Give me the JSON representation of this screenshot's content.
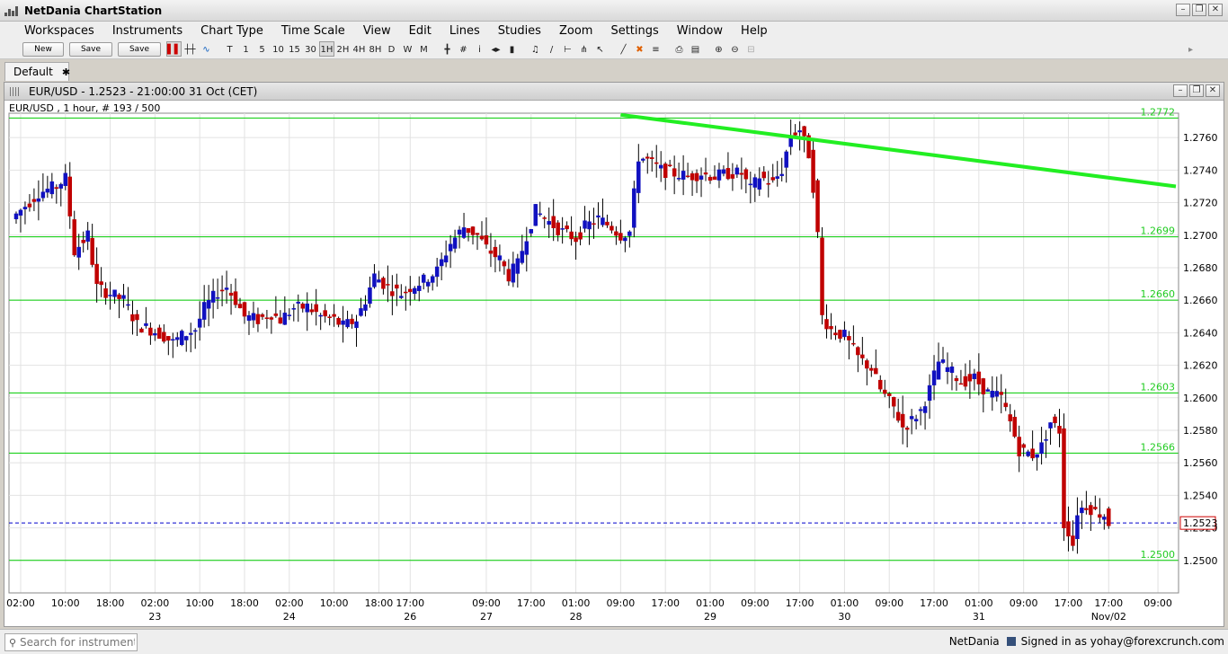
{
  "window": {
    "title": "NetDania ChartStation"
  },
  "menu": [
    "Workspaces",
    "Instruments",
    "Chart Type",
    "Time Scale",
    "View",
    "Edit",
    "Lines",
    "Studies",
    "Zoom",
    "Settings",
    "Window",
    "Help"
  ],
  "toolbar": {
    "new_label": "New",
    "save_label": "Save",
    "saveas_label": "Save as..",
    "chart_type_icons": [
      "candlestick-icon",
      "ohlc-bars-icon",
      "line-chart-icon"
    ],
    "interval_buttons": [
      "T",
      "1",
      "5",
      "10",
      "15",
      "30",
      "1H",
      "2H",
      "4H",
      "8H",
      "D",
      "W",
      "M"
    ],
    "selected_interval": "1H"
  },
  "tabs": [
    {
      "label": "Default"
    }
  ],
  "chart": {
    "title": "EUR/USD - 1.2523 - 21:00:00  31 Oct (CET)",
    "info": "EUR/USD , 1 hour, # 193 / 500"
  },
  "status": {
    "search_placeholder": "Search for instrument",
    "brand": "NetDania",
    "signed_in": "Signed in as yohay@forexcrunch.com"
  },
  "chart_data": {
    "type": "candlestick",
    "instrument": "EUR/USD",
    "interval": "1 hour",
    "last_price": 1.2523,
    "ylim": [
      1.248,
      1.2775
    ],
    "yticks": [
      1.25,
      1.252,
      1.254,
      1.256,
      1.258,
      1.26,
      1.262,
      1.264,
      1.266,
      1.268,
      1.27,
      1.272,
      1.274,
      1.276
    ],
    "ytick_labels": [
      "1.2500",
      "1.2520",
      "1.2540",
      "1.2560",
      "1.2580",
      "1.2600",
      "1.2620",
      "1.2640",
      "1.2660",
      "1.2680",
      "1.2700",
      "1.2720",
      "1.2740",
      "1.2760"
    ],
    "x_ticks": [
      {
        "i": 2,
        "time": "02:00",
        "date": ""
      },
      {
        "i": 12,
        "time": "10:00",
        "date": ""
      },
      {
        "i": 22,
        "time": "18:00",
        "date": ""
      },
      {
        "i": 32,
        "time": "02:00",
        "date": "23"
      },
      {
        "i": 42,
        "time": "10:00",
        "date": ""
      },
      {
        "i": 52,
        "time": "18:00",
        "date": ""
      },
      {
        "i": 62,
        "time": "02:00",
        "date": "24"
      },
      {
        "i": 72,
        "time": "10:00",
        "date": ""
      },
      {
        "i": 82,
        "time": "18:00",
        "date": ""
      },
      {
        "i": 89,
        "time": "17:00",
        "date": "26"
      },
      {
        "i": 106,
        "time": "09:00",
        "date": "27"
      },
      {
        "i": 116,
        "time": "17:00",
        "date": ""
      },
      {
        "i": 126,
        "time": "01:00",
        "date": "28"
      },
      {
        "i": 136,
        "time": "09:00",
        "date": ""
      },
      {
        "i": 146,
        "time": "17:00",
        "date": ""
      },
      {
        "i": 156,
        "time": "01:00",
        "date": "29"
      },
      {
        "i": 166,
        "time": "09:00",
        "date": ""
      },
      {
        "i": 176,
        "time": "17:00",
        "date": ""
      },
      {
        "i": 186,
        "time": "01:00",
        "date": "30"
      },
      {
        "i": 196,
        "time": "09:00",
        "date": ""
      },
      {
        "i": 206,
        "time": "17:00",
        "date": ""
      },
      {
        "i": 216,
        "time": "01:00",
        "date": "31"
      },
      {
        "i": 226,
        "time": "09:00",
        "date": ""
      },
      {
        "i": 236,
        "time": "17:00",
        "date": ""
      },
      {
        "i": 245,
        "time": "17:00",
        "date": "Nov/02"
      },
      {
        "i": 256,
        "time": "09:00",
        "date": ""
      }
    ],
    "horizontal_lines": [
      {
        "value": 1.2772,
        "label": "1.2772",
        "color": "#00cc00"
      },
      {
        "value": 1.2699,
        "label": "1.2699",
        "color": "#00cc00"
      },
      {
        "value": 1.266,
        "label": "1.2660",
        "color": "#00cc00"
      },
      {
        "value": 1.2603,
        "label": "1.2603",
        "color": "#00cc00"
      },
      {
        "value": 1.2566,
        "label": "1.2566",
        "color": "#00cc00"
      },
      {
        "value": 1.25,
        "label": "1.2500",
        "color": "#00cc00"
      }
    ],
    "trendline": {
      "start": {
        "i": 136,
        "value": 1.2774
      },
      "end": {
        "i": 260,
        "value": 1.273
      },
      "color": "#22ee22"
    },
    "last_price_line": {
      "value": 1.2523,
      "label": "1.2523",
      "color": "#0000cc"
    },
    "up_color": "#1010c0",
    "down_color": "#c00000",
    "ohlc_keypoints": [
      [
        0,
        1.271
      ],
      [
        3,
        1.2718
      ],
      [
        6,
        1.2726
      ],
      [
        10,
        1.273
      ],
      [
        12,
        1.2735
      ],
      [
        14,
        1.269
      ],
      [
        17,
        1.27
      ],
      [
        19,
        1.2668
      ],
      [
        22,
        1.2664
      ],
      [
        25,
        1.266
      ],
      [
        28,
        1.2645
      ],
      [
        31,
        1.2642
      ],
      [
        34,
        1.2638
      ],
      [
        36,
        1.2634
      ],
      [
        38,
        1.2638
      ],
      [
        41,
        1.2642
      ],
      [
        43,
        1.2655
      ],
      [
        46,
        1.2665
      ],
      [
        48,
        1.2668
      ],
      [
        50,
        1.266
      ],
      [
        52,
        1.265
      ],
      [
        55,
        1.2648
      ],
      [
        58,
        1.2652
      ],
      [
        60,
        1.2648
      ],
      [
        63,
        1.2655
      ],
      [
        66,
        1.2656
      ],
      [
        69,
        1.265
      ],
      [
        72,
        1.2648
      ],
      [
        74,
        1.2644
      ],
      [
        77,
        1.2648
      ],
      [
        79,
        1.266
      ],
      [
        81,
        1.2675
      ],
      [
        84,
        1.2668
      ],
      [
        87,
        1.2664
      ],
      [
        89,
        1.2668
      ],
      [
        92,
        1.2672
      ],
      [
        95,
        1.2678
      ],
      [
        98,
        1.2695
      ],
      [
        101,
        1.2705
      ],
      [
        104,
        1.27
      ],
      [
        106,
        1.2692
      ],
      [
        109,
        1.2685
      ],
      [
        111,
        1.2675
      ],
      [
        113,
        1.2682
      ],
      [
        115,
        1.27
      ],
      [
        117,
        1.2715
      ],
      [
        120,
        1.2708
      ],
      [
        123,
        1.2702
      ],
      [
        126,
        1.2698
      ],
      [
        128,
        1.2705
      ],
      [
        131,
        1.271
      ],
      [
        134,
        1.2705
      ],
      [
        136,
        1.27
      ],
      [
        138,
        1.2702
      ],
      [
        140,
        1.2748
      ],
      [
        142,
        1.2746
      ],
      [
        145,
        1.274
      ],
      [
        148,
        1.2738
      ],
      [
        151,
        1.2736
      ],
      [
        154,
        1.2738
      ],
      [
        157,
        1.2736
      ],
      [
        160,
        1.2738
      ],
      [
        163,
        1.2738
      ],
      [
        165,
        1.2728
      ],
      [
        167,
        1.2736
      ],
      [
        170,
        1.2732
      ],
      [
        172,
        1.274
      ],
      [
        174,
        1.2762
      ],
      [
        176,
        1.2765
      ],
      [
        178,
        1.275
      ],
      [
        179,
        1.273
      ],
      [
        180,
        1.27
      ],
      [
        181,
        1.265
      ],
      [
        183,
        1.2642
      ],
      [
        186,
        1.2638
      ],
      [
        189,
        1.2625
      ],
      [
        192,
        1.2618
      ],
      [
        194,
        1.2605
      ],
      [
        197,
        1.2594
      ],
      [
        199,
        1.2582
      ],
      [
        201,
        1.2586
      ],
      [
        203,
        1.2592
      ],
      [
        205,
        1.2605
      ],
      [
        207,
        1.2622
      ],
      [
        209,
        1.2618
      ],
      [
        212,
        1.261
      ],
      [
        215,
        1.2612
      ],
      [
        218,
        1.2603
      ],
      [
        221,
        1.26
      ],
      [
        223,
        1.2585
      ],
      [
        225,
        1.2568
      ],
      [
        228,
        1.2565
      ],
      [
        230,
        1.257
      ],
      [
        232,
        1.2585
      ],
      [
        234,
        1.258
      ],
      [
        235,
        1.2522
      ],
      [
        236,
        1.2518
      ],
      [
        237,
        1.251
      ],
      [
        238,
        1.253
      ],
      [
        240,
        1.2534
      ],
      [
        242,
        1.253
      ],
      [
        244,
        1.2528
      ],
      [
        245,
        1.2523
      ]
    ]
  }
}
